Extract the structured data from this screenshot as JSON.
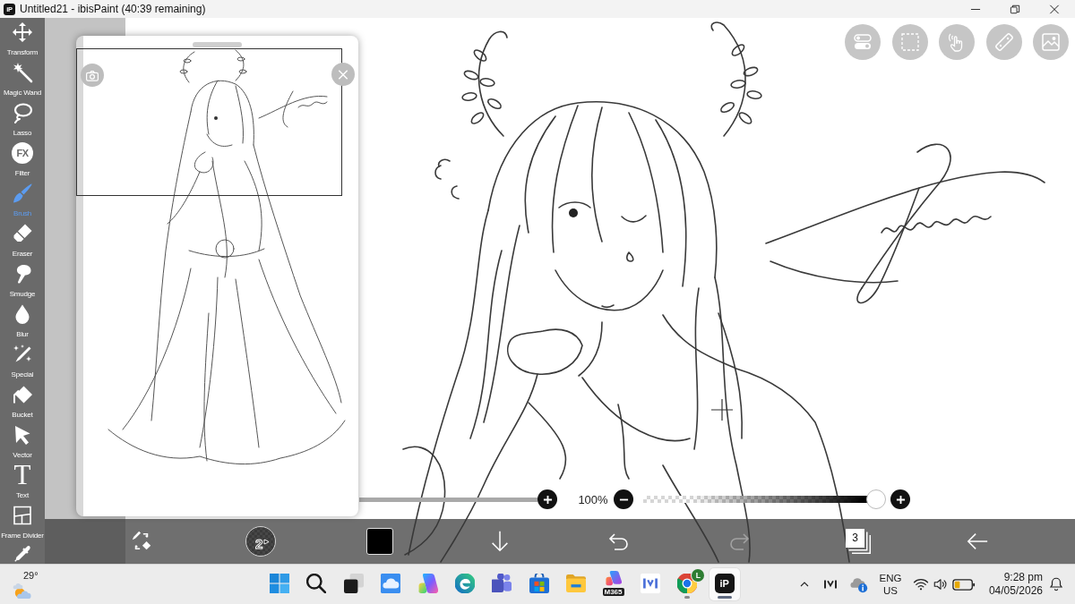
{
  "window": {
    "logo": "iP",
    "title": "Untitled21 - ibisPaint (40:39 remaining)"
  },
  "tools": [
    {
      "label": "Transform",
      "selected": false
    },
    {
      "label": "Magic Wand",
      "selected": false
    },
    {
      "label": "Lasso",
      "selected": false
    },
    {
      "glyph": "FX",
      "label": "Filter",
      "selected": false
    },
    {
      "label": "Brush",
      "selected": true
    },
    {
      "label": "Eraser",
      "selected": false
    },
    {
      "label": "Smudge",
      "selected": false
    },
    {
      "label": "Blur",
      "selected": false
    },
    {
      "label": "Special",
      "selected": false
    },
    {
      "label": "Bucket",
      "selected": false
    },
    {
      "label": "Vector",
      "selected": false
    },
    {
      "glyph": "T",
      "label": "Text",
      "selected": false
    },
    {
      "label": "Frame Divider",
      "selected": false
    },
    {
      "selected": false
    }
  ],
  "opacity_slider": {
    "reading": "100%",
    "level": 1
  },
  "bottom_bar": {
    "brush_size": "2",
    "color": "#000000",
    "undo": {
      "disabled": false
    },
    "redo": {
      "disabled": true
    },
    "layer_count": "3"
  },
  "taskbar": {
    "weather": {
      "temperature": "29°"
    },
    "apps": [
      {
        "running": false,
        "selected": false
      },
      {
        "running": false,
        "selected": false
      },
      {
        "running": false,
        "selected": false
      },
      {
        "running": false,
        "selected": false
      },
      {
        "running": false,
        "selected": false
      },
      {
        "running": false,
        "selected": false
      },
      {
        "running": false,
        "selected": false
      },
      {
        "running": false,
        "selected": false
      },
      {
        "running": false,
        "selected": false
      },
      {
        "label": "M365",
        "running": false,
        "selected": false
      },
      {
        "running": false,
        "selected": false
      },
      {
        "badge": "L",
        "running": true,
        "selected": false
      },
      {
        "logo": "iP",
        "running": true,
        "selected": true
      }
    ],
    "tray": {
      "language": "ENG",
      "region": "US",
      "time": "9:28 pm",
      "date": "04/05/2026"
    }
  }
}
